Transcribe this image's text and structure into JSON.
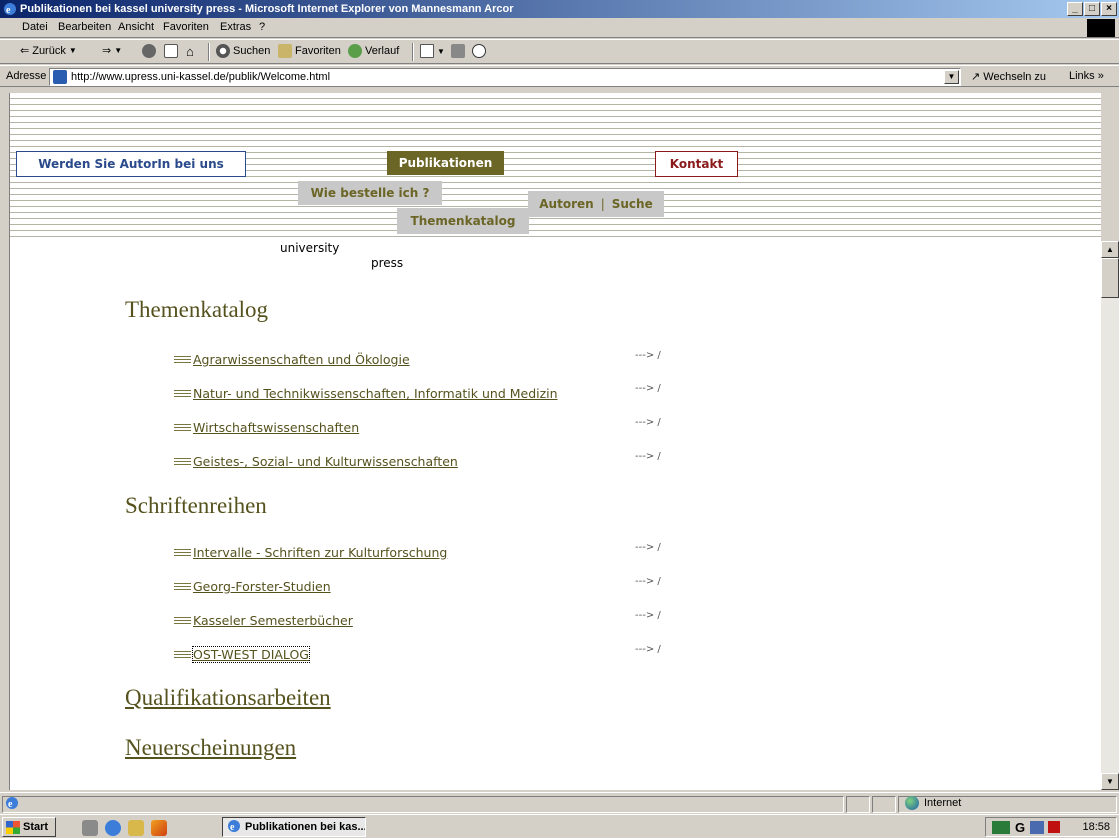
{
  "window": {
    "title": "Publikationen bei kassel university press - Microsoft Internet Explorer von Mannesmann Arcor",
    "controls": [
      "_",
      "□",
      "×"
    ]
  },
  "menu": [
    "Datei",
    "Bearbeiten",
    "Ansicht",
    "Favoriten",
    "Extras",
    "?"
  ],
  "toolbar": {
    "back": "Zurück",
    "search": "Suchen",
    "favorites": "Favoriten",
    "history": "Verlauf"
  },
  "address": {
    "label": "Adresse",
    "url": "http://www.upress.uni-kassel.de/publik/Welcome.html",
    "go": "Wechseln zu",
    "links": "Links"
  },
  "nav": {
    "autor": "Werden Sie AutorIn bei uns",
    "publikationen": "Publikationen",
    "kontakt": "Kontakt",
    "bestelle": "Wie bestelle ich ?",
    "themenkatalog": "Themenkatalog",
    "autoren": "Autoren",
    "separator": "|",
    "suche": "Suche"
  },
  "logo": {
    "line1": "university",
    "line2": "press"
  },
  "content": {
    "themenkatalog": {
      "heading": "Themenkatalog",
      "items": [
        {
          "label": "Agrarwissenschaften und Ökologie",
          "arrow": "---> /"
        },
        {
          "label": "Natur- und Technikwissenschaften, Informatik und Medizin",
          "arrow": "---> /"
        },
        {
          "label": "Wirtschaftswissenschaften",
          "arrow": "---> /"
        },
        {
          "label": "Geistes-, Sozial- und Kulturwissenschaften",
          "arrow": "---> /"
        }
      ]
    },
    "schriftenreihen": {
      "heading": "Schriftenreihen",
      "items": [
        {
          "label": "Intervalle - Schriften zur Kulturforschung",
          "arrow": "---> /"
        },
        {
          "label": "Georg-Forster-Studien",
          "arrow": "---> /"
        },
        {
          "label": "Kasseler Semesterbücher",
          "arrow": "---> /"
        },
        {
          "label": "OST-WEST DIALOG",
          "arrow": "---> /"
        }
      ]
    },
    "qualifikationsarbeiten": "Qualifikationsarbeiten",
    "neuerscheinungen": "Neuerscheinungen"
  },
  "status": {
    "zone": "Internet"
  },
  "taskbar": {
    "start": "Start",
    "task": "Publikationen bei kas...",
    "tray_letter": "G",
    "clock": "18:58"
  }
}
